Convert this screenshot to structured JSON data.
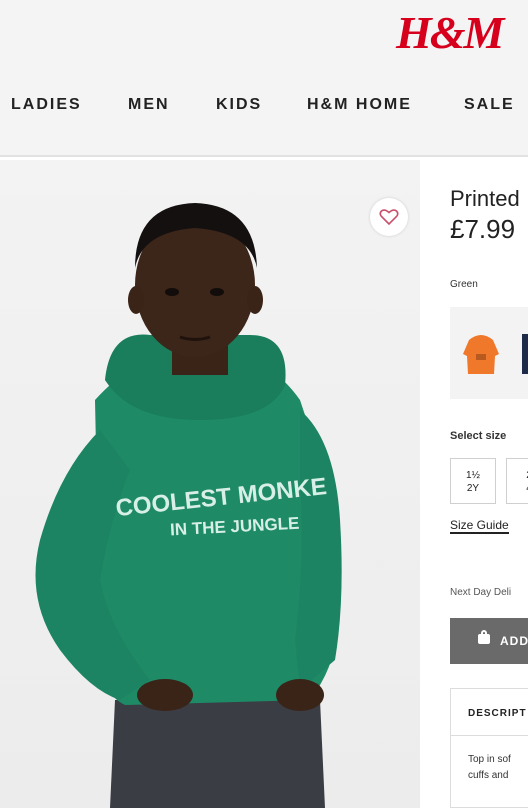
{
  "brand": {
    "logo_text": "H&M",
    "logo_color": "#d6001c"
  },
  "nav": {
    "items": [
      "LADIES",
      "MEN",
      "KIDS",
      "H&M HOME",
      "SALE"
    ]
  },
  "product": {
    "image": {
      "hoodie_print_line1": "COOLEST MONKE",
      "hoodie_print_line2": "IN THE JUNGLE",
      "hoodie_color": "#1e8a66"
    },
    "favorite_icon": "heart-icon",
    "title": "Printed",
    "price": "£7.99",
    "color_label": "Green",
    "swatches": [
      {
        "name": "orange",
        "color": "#f0782a"
      },
      {
        "name": "navy",
        "color": "#1d2a4a"
      }
    ],
    "size_label": "Select size",
    "sizes": [
      {
        "line1": "1½",
        "line2": "2Y"
      },
      {
        "line1": "2",
        "line2": "4"
      }
    ],
    "size_guide": "Size Guide",
    "delivery": "Next Day Deli",
    "add_button": "ADD",
    "description_heading": "DESCRIPT",
    "description_lines": [
      "Top in sof",
      "cuffs and"
    ]
  }
}
